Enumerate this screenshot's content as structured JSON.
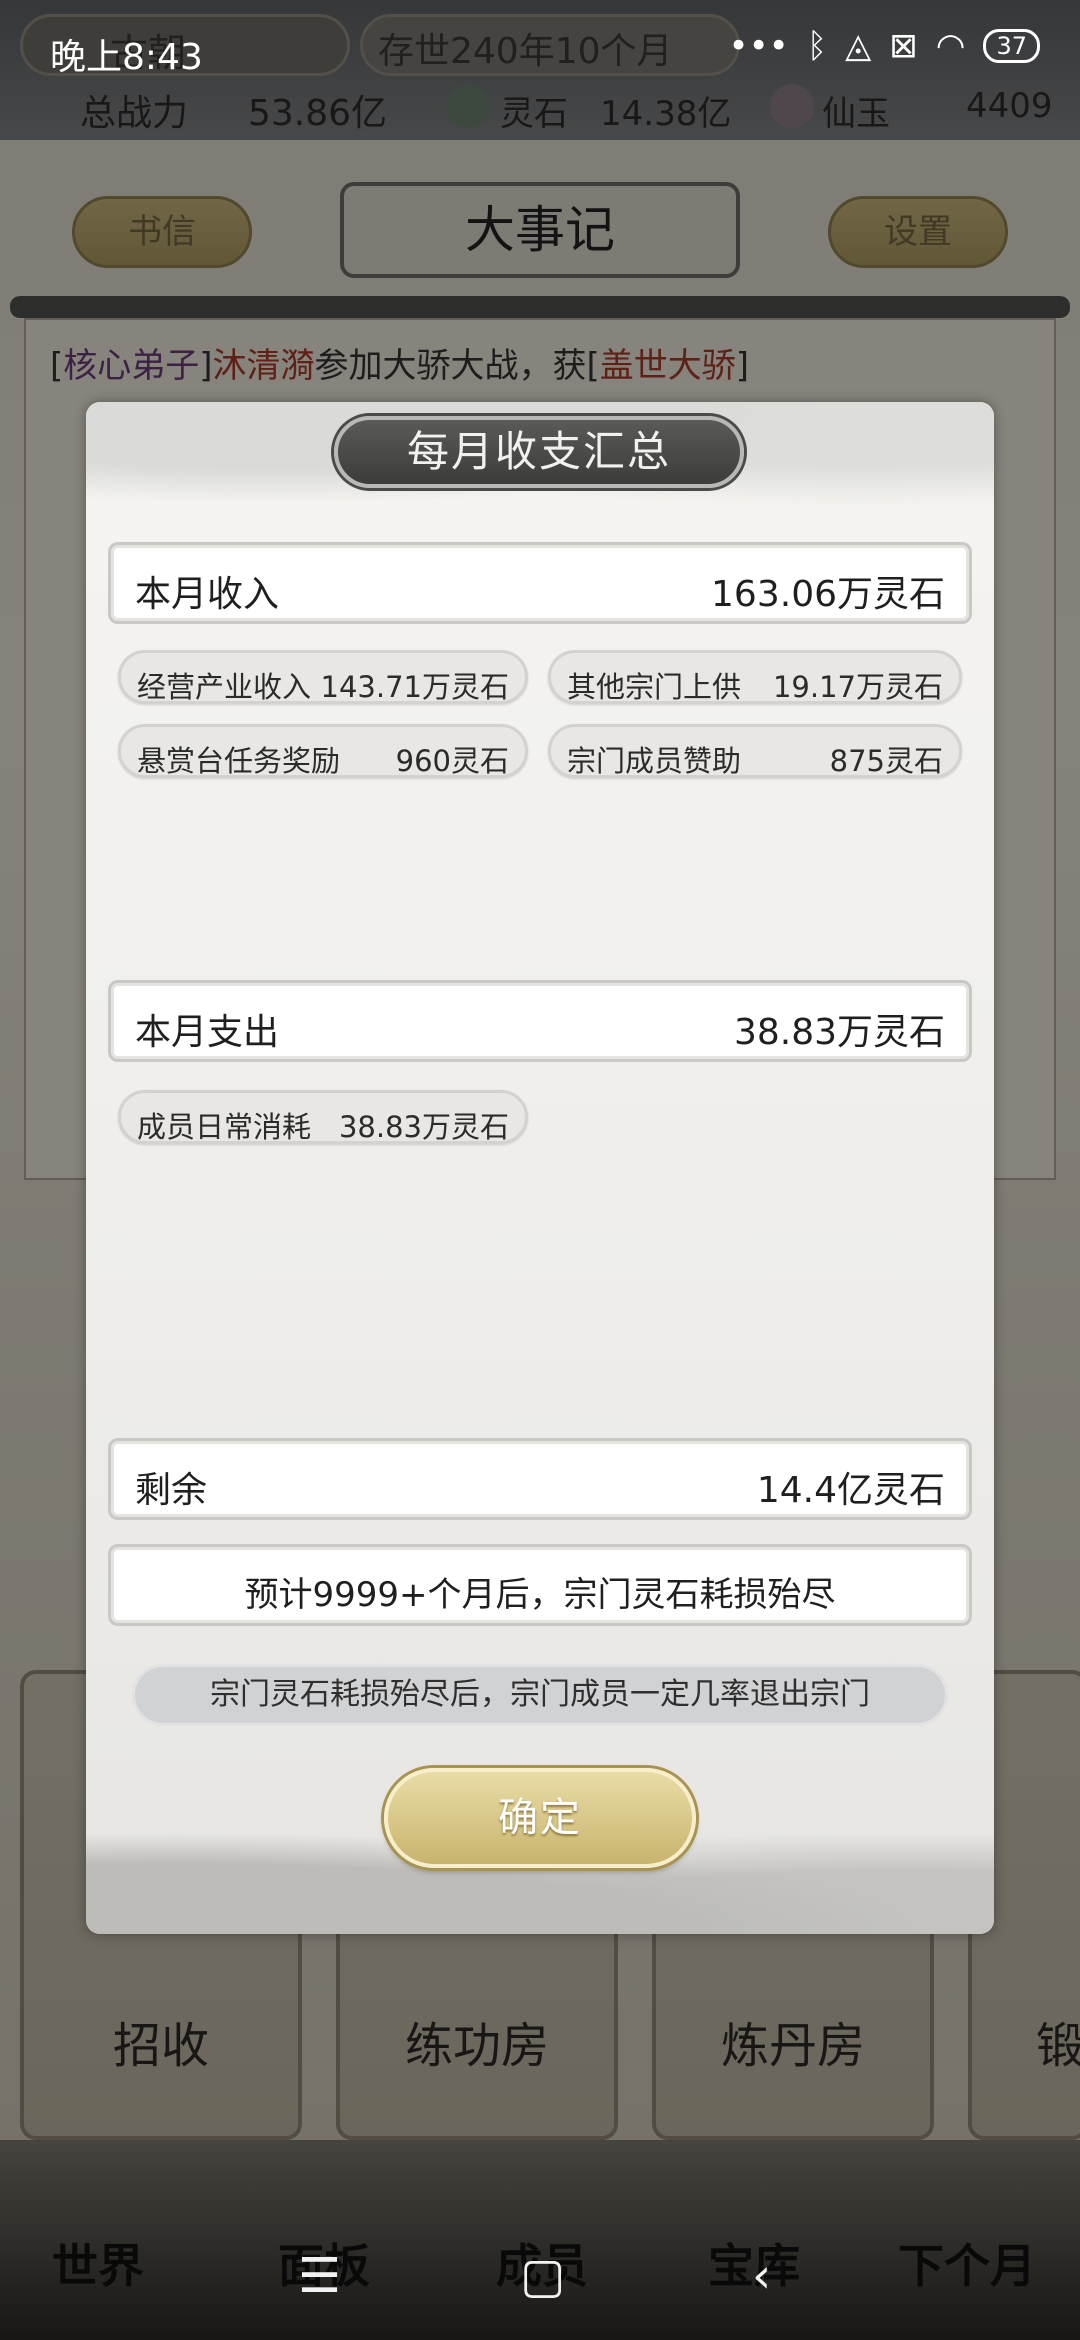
{
  "status_bar": {
    "time": "晚上8:43",
    "battery": "37",
    "icons": [
      "more-icon",
      "bluetooth-icon",
      "mute-icon",
      "sim-icon",
      "wifi-icon",
      "battery-icon"
    ]
  },
  "game_header": {
    "sect_name": "古朝",
    "date": "存世240年10个月",
    "power_label": "总战力",
    "power_value": "53.86亿",
    "spirit_stone_label": "灵石",
    "spirit_stone_value": "14.38亿",
    "jade_label": "仙玉",
    "jade_value": "4409",
    "letters_button": "书信",
    "page_title": "大事记",
    "settings_button": "设置"
  },
  "log": {
    "first_line": {
      "role": "核心弟子",
      "name": "沐清漪",
      "text": "参加大骄大战，获",
      "award": "盖世大骄"
    }
  },
  "buildings": [
    "招收",
    "练功房",
    "炼丹房",
    "锻"
  ],
  "bottom_nav": [
    "世界",
    "面板",
    "成员",
    "宝库",
    "下个月"
  ],
  "modal": {
    "title": "每月收支汇总",
    "income": {
      "label": "本月收入",
      "value": "163.06万灵石",
      "items": [
        {
          "label": "经营产业收入",
          "value": "143.71万灵石"
        },
        {
          "label": "其他宗门上供",
          "value": "19.17万灵石"
        },
        {
          "label": "悬赏台任务奖励",
          "value": "960灵石"
        },
        {
          "label": "宗门成员赞助",
          "value": "875灵石"
        }
      ]
    },
    "expense": {
      "label": "本月支出",
      "value": "38.83万灵石",
      "items": [
        {
          "label": "成员日常消耗",
          "value": "38.83万灵石"
        }
      ]
    },
    "remaining": {
      "label": "剩余",
      "value": "14.4亿灵石"
    },
    "forecast": "预计9999+个月后，宗门灵石耗损殆尽",
    "warning": "宗门灵石耗损殆尽后，宗门成员一定几率退出宗门",
    "confirm_label": "确定"
  }
}
